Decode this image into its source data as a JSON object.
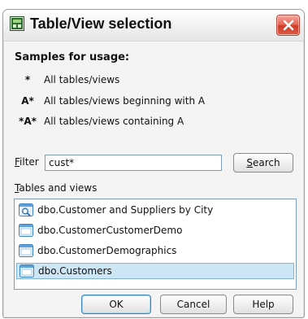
{
  "window": {
    "title": "Table/View selection"
  },
  "samples": {
    "heading": "Samples for usage:",
    "items": [
      {
        "pattern": "*",
        "description": "All tables/views"
      },
      {
        "pattern": "A*",
        "description": "All tables/views beginning with A"
      },
      {
        "pattern": "*A*",
        "description": "All tables/views containing A"
      }
    ]
  },
  "filter": {
    "label_mnemonic": "F",
    "label_rest": "ilter",
    "value": "cust*",
    "search_button_mnemonic": "S",
    "search_button_rest": "earch"
  },
  "list": {
    "label_mnemonic": "T",
    "label_rest": "ables and views",
    "items": [
      {
        "label": "dbo.Customer and Suppliers by City",
        "icon": "view-icon"
      },
      {
        "label": "dbo.CustomerCustomerDemo",
        "icon": "table-icon"
      },
      {
        "label": "dbo.CustomerDemographics",
        "icon": "table-icon"
      },
      {
        "label": "dbo.Customers",
        "icon": "table-icon"
      }
    ],
    "selected_index": 3
  },
  "buttons": {
    "ok": "OK",
    "cancel": "Cancel",
    "help": "Help"
  },
  "colors": {
    "selection_bg": "#cde6f6",
    "close_button": "#d9473a",
    "title_icon": "#2e6b2e"
  }
}
